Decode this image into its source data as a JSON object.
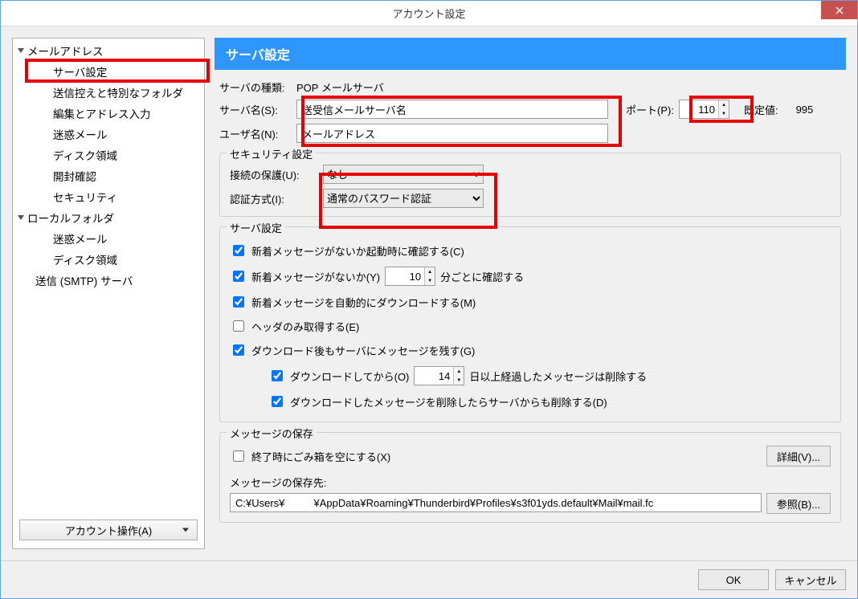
{
  "window": {
    "title": "アカウント設定"
  },
  "sidebar": {
    "mail_address": "メールアドレス",
    "server_settings": "サーバ設定",
    "copies_folders": "送信控えと特別なフォルダ",
    "composition": "編集とアドレス入力",
    "junk": "迷惑メール",
    "disk": "ディスク領域",
    "receipts": "開封確認",
    "security": "セキュリティ",
    "local_folders": "ローカルフォルダ",
    "local_junk": "迷惑メール",
    "local_disk": "ディスク領域",
    "smtp": "送信 (SMTP) サーバ",
    "account_ops": "アカウント操作(A)"
  },
  "header": {
    "title": "サーバ設定"
  },
  "top": {
    "server_type_label": "サーバの種類:",
    "server_type_value": "POP メールサーバ",
    "server_name_label": "サーバ名(S):",
    "server_name_value": "送受信メールサーバ名",
    "port_label": "ポート(P):",
    "port_value": "110",
    "default_label": "既定値:",
    "default_value": "995",
    "user_label": "ユーザ名(N):",
    "user_value": "メールアドレス"
  },
  "security": {
    "legend": "セキュリティ設定",
    "connection_label": "接続の保護(U):",
    "connection_value": "なし",
    "auth_label": "認証方式(I):",
    "auth_value": "通常のパスワード認証"
  },
  "server_sec": {
    "legend": "サーバ設定",
    "chk_startup": "新着メッセージがないか起動時に確認する(C)",
    "chk_interval_pre": "新着メッセージがないか(Y)",
    "interval_value": "10",
    "chk_interval_post": "分ごとに確認する",
    "chk_autodl": "新着メッセージを自動的にダウンロードする(M)",
    "chk_header": "ヘッダのみ取得する(E)",
    "chk_leave": "ダウンロード後もサーバにメッセージを残す(G)",
    "chk_days_pre": "ダウンロードしてから(O)",
    "days_value": "14",
    "chk_days_post": "日以上経過したメッセージは削除する",
    "chk_remove": "ダウンロードしたメッセージを削除したらサーバからも削除する(D)"
  },
  "storage": {
    "legend": "メッセージの保存",
    "chk_empty": "終了時にごみ箱を空にする(X)",
    "advanced_btn": "詳細(V)...",
    "path_label": "メッセージの保存先:",
    "path_value": "C:¥Users¥          ¥AppData¥Roaming¥Thunderbird¥Profiles¥s3f01yds.default¥Mail¥mail.fc",
    "browse_btn": "参照(B)..."
  },
  "buttons": {
    "ok": "OK",
    "cancel": "キャンセル"
  }
}
